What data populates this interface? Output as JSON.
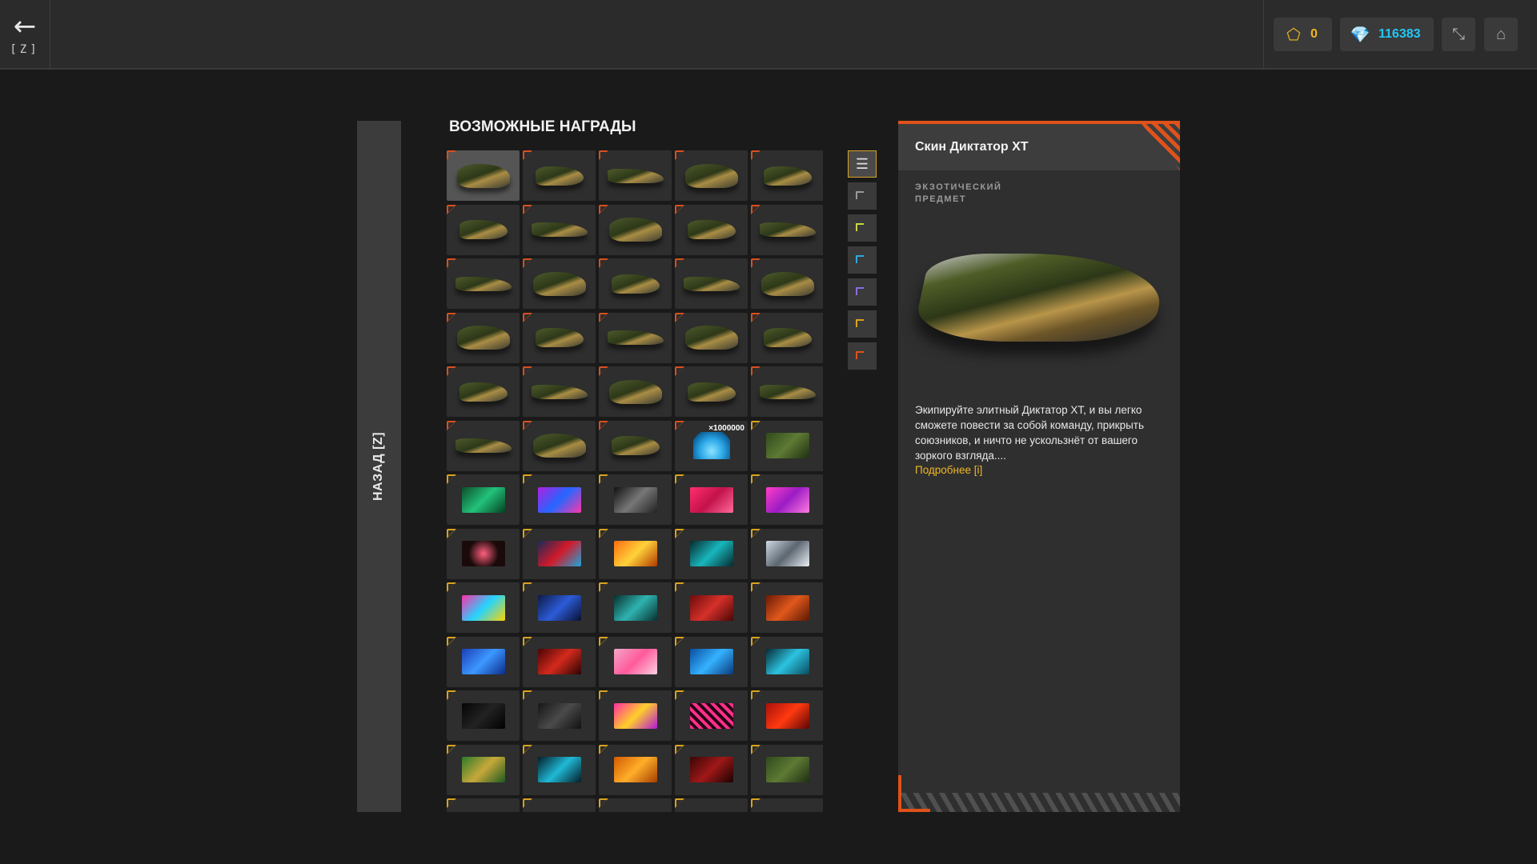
{
  "topbar": {
    "back_key": "[Z]",
    "back_icon": "arrow-left-icon",
    "gold_value": "0",
    "crystals_value": "116383",
    "colors": {
      "gold": "#f2b822",
      "crystal": "#23c7f5"
    }
  },
  "side_back": {
    "label": "НАЗАД [Z]"
  },
  "rewards": {
    "title": "ВОЗМОЖНЫЕ НАГРАДЫ",
    "crystal_qty": "×1000000"
  },
  "detail": {
    "title": "Скин Диктатор XT",
    "rarity": "ЭКЗОТИЧЕСКИЙ ПРЕДМЕТ",
    "description": "Экипируйте элитный Диктатор XT, и вы легко сможете повести за собой команду, прикрыть союзников, и ничто не ускользнёт от вашего зоркого взгляда....",
    "more_link": "Подробнее [i]",
    "accent": "#e0521a"
  },
  "filter_colors": [
    "#9a9a9a",
    "#c8d642",
    "#2ea8e0",
    "#8a6de0",
    "#d9a320",
    "#e0521a"
  ]
}
